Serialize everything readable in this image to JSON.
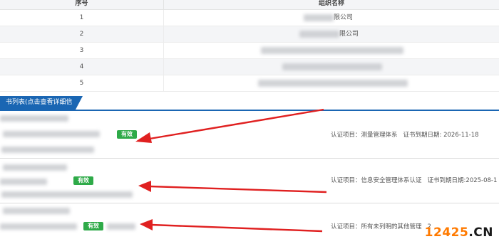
{
  "org_table": {
    "headers": {
      "no": "序号",
      "name": "组织名称"
    },
    "rows": [
      {
        "no": "1",
        "name_visible": "限公司"
      },
      {
        "no": "2",
        "name_visible": "限公司"
      },
      {
        "no": "3",
        "name_visible": ""
      },
      {
        "no": "4",
        "name_visible": ""
      },
      {
        "no": "5",
        "name_visible": ""
      }
    ]
  },
  "cert_section": {
    "tab_label": "书列表(点击查看详细信息)",
    "items": [
      {
        "status": "有效",
        "project_label": "认证项目：",
        "project": "测量管理体系",
        "expiry_label": "证书到期日期:",
        "expiry": "2026-11-18"
      },
      {
        "status": "有效",
        "project_label": "认证项目：",
        "project": "信息安全管理体系认证",
        "expiry_label": "证书到期日期:",
        "expiry": "2025-08-1"
      },
      {
        "status": "有效",
        "project_label": "认证项目：",
        "project": "所有未列明的其他管理",
        "expiry_label": "",
        "expiry": "2"
      }
    ]
  },
  "colors": {
    "badge": "#2eaa48",
    "tab": "#1a66b3",
    "arrow": "#e02020"
  },
  "watermark": {
    "part1": "12425",
    "part2": ".CN"
  }
}
